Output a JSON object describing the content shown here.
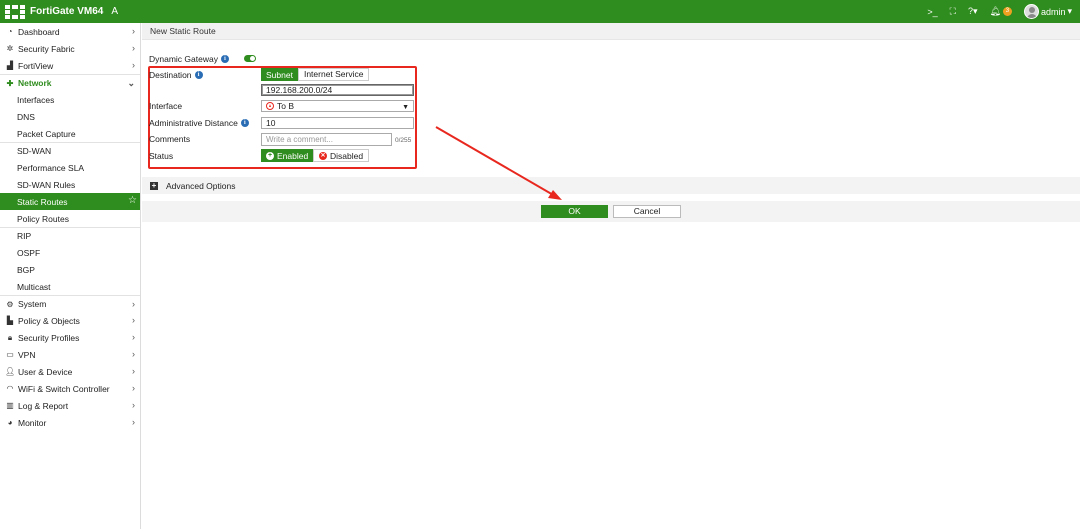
{
  "topbar": {
    "brand": "FortiGate VM64",
    "brand_suffix": "A",
    "cli_icon": "terminal-icon",
    "fullscreen_icon": "fullscreen-icon",
    "help_icon": "help-icon",
    "notifications_count": "3",
    "user": "admin"
  },
  "sidebar": {
    "items": [
      {
        "label": "Dashboard",
        "icon": "dashboard-icon",
        "chevron": "›"
      },
      {
        "label": "Security Fabric",
        "icon": "security-fabric-icon",
        "chevron": "›"
      },
      {
        "label": "FortiView",
        "icon": "fortiview-icon",
        "chevron": "›"
      },
      {
        "label": "Network",
        "icon": "network-icon",
        "chevron": "⌄"
      },
      {
        "label": "Interfaces"
      },
      {
        "label": "DNS"
      },
      {
        "label": "Packet Capture"
      },
      {
        "label": "SD-WAN"
      },
      {
        "label": "Performance SLA"
      },
      {
        "label": "SD-WAN Rules"
      },
      {
        "label": "Static Routes"
      },
      {
        "label": "Policy Routes"
      },
      {
        "label": "RIP"
      },
      {
        "label": "OSPF"
      },
      {
        "label": "BGP"
      },
      {
        "label": "Multicast"
      },
      {
        "label": "System",
        "icon": "gear-icon",
        "chevron": "›"
      },
      {
        "label": "Policy & Objects",
        "icon": "policy-icon",
        "chevron": "›"
      },
      {
        "label": "Security Profiles",
        "icon": "lock-icon",
        "chevron": "›"
      },
      {
        "label": "VPN",
        "icon": "vpn-icon",
        "chevron": "›"
      },
      {
        "label": "User & Device",
        "icon": "user-icon",
        "chevron": "›"
      },
      {
        "label": "WiFi & Switch Controller",
        "icon": "wifi-icon",
        "chevron": "›"
      },
      {
        "label": "Log & Report",
        "icon": "chart-icon",
        "chevron": "›"
      },
      {
        "label": "Monitor",
        "icon": "monitor-icon",
        "chevron": "›"
      }
    ]
  },
  "main": {
    "title": "New Static Route",
    "form": {
      "dynamic_gateway_label": "Dynamic Gateway",
      "destination_label": "Destination",
      "destination_options": [
        "Subnet",
        "Internet Service"
      ],
      "destination_value": "192.168.200.0/24",
      "interface_label": "Interface",
      "interface_value": "To B",
      "admin_distance_label": "Administrative Distance",
      "admin_distance_value": "10",
      "comments_label": "Comments",
      "comments_placeholder": "Write a comment...",
      "comments_counter": "0/255",
      "status_label": "Status",
      "status_enabled": "Enabled",
      "status_disabled": "Disabled"
    },
    "advanced_options_label": "Advanced Options",
    "ok_label": "OK",
    "cancel_label": "Cancel"
  },
  "colors": {
    "brand_green": "#2f8c1e",
    "annotation_red": "#e8281f"
  }
}
